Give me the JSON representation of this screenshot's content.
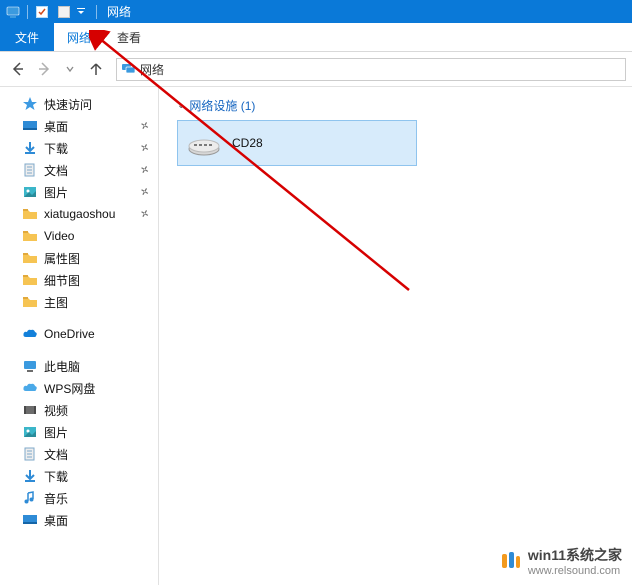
{
  "title": "网络",
  "ribbon": {
    "file": "文件",
    "network": "网络",
    "view": "查看"
  },
  "address": {
    "location": "网络"
  },
  "sidebar": {
    "quick_access": "快速访问",
    "quick_items": [
      {
        "label": "桌面",
        "icon": "desktop",
        "pinned": true
      },
      {
        "label": "下载",
        "icon": "download",
        "pinned": true
      },
      {
        "label": "文档",
        "icon": "document",
        "pinned": true
      },
      {
        "label": "图片",
        "icon": "pictures",
        "pinned": true
      },
      {
        "label": "xiatugaoshou",
        "icon": "folder",
        "pinned": true
      },
      {
        "label": "Video",
        "icon": "folder",
        "pinned": false
      },
      {
        "label": "属性图",
        "icon": "folder",
        "pinned": false
      },
      {
        "label": "细节图",
        "icon": "folder",
        "pinned": false
      },
      {
        "label": "主图",
        "icon": "folder",
        "pinned": false
      }
    ],
    "onedrive": "OneDrive",
    "this_pc": "此电脑",
    "pc_items": [
      {
        "label": "WPS网盘",
        "icon": "cloud"
      },
      {
        "label": "视频",
        "icon": "video"
      },
      {
        "label": "图片",
        "icon": "pictures"
      },
      {
        "label": "文档",
        "icon": "document"
      },
      {
        "label": "下载",
        "icon": "download"
      },
      {
        "label": "音乐",
        "icon": "music"
      },
      {
        "label": "桌面",
        "icon": "desktop"
      }
    ]
  },
  "content": {
    "group_label": "网络设施 (1)",
    "device_name": "CD28"
  },
  "watermark": {
    "main": "win11系统之家",
    "url": "www.relsound.com"
  }
}
